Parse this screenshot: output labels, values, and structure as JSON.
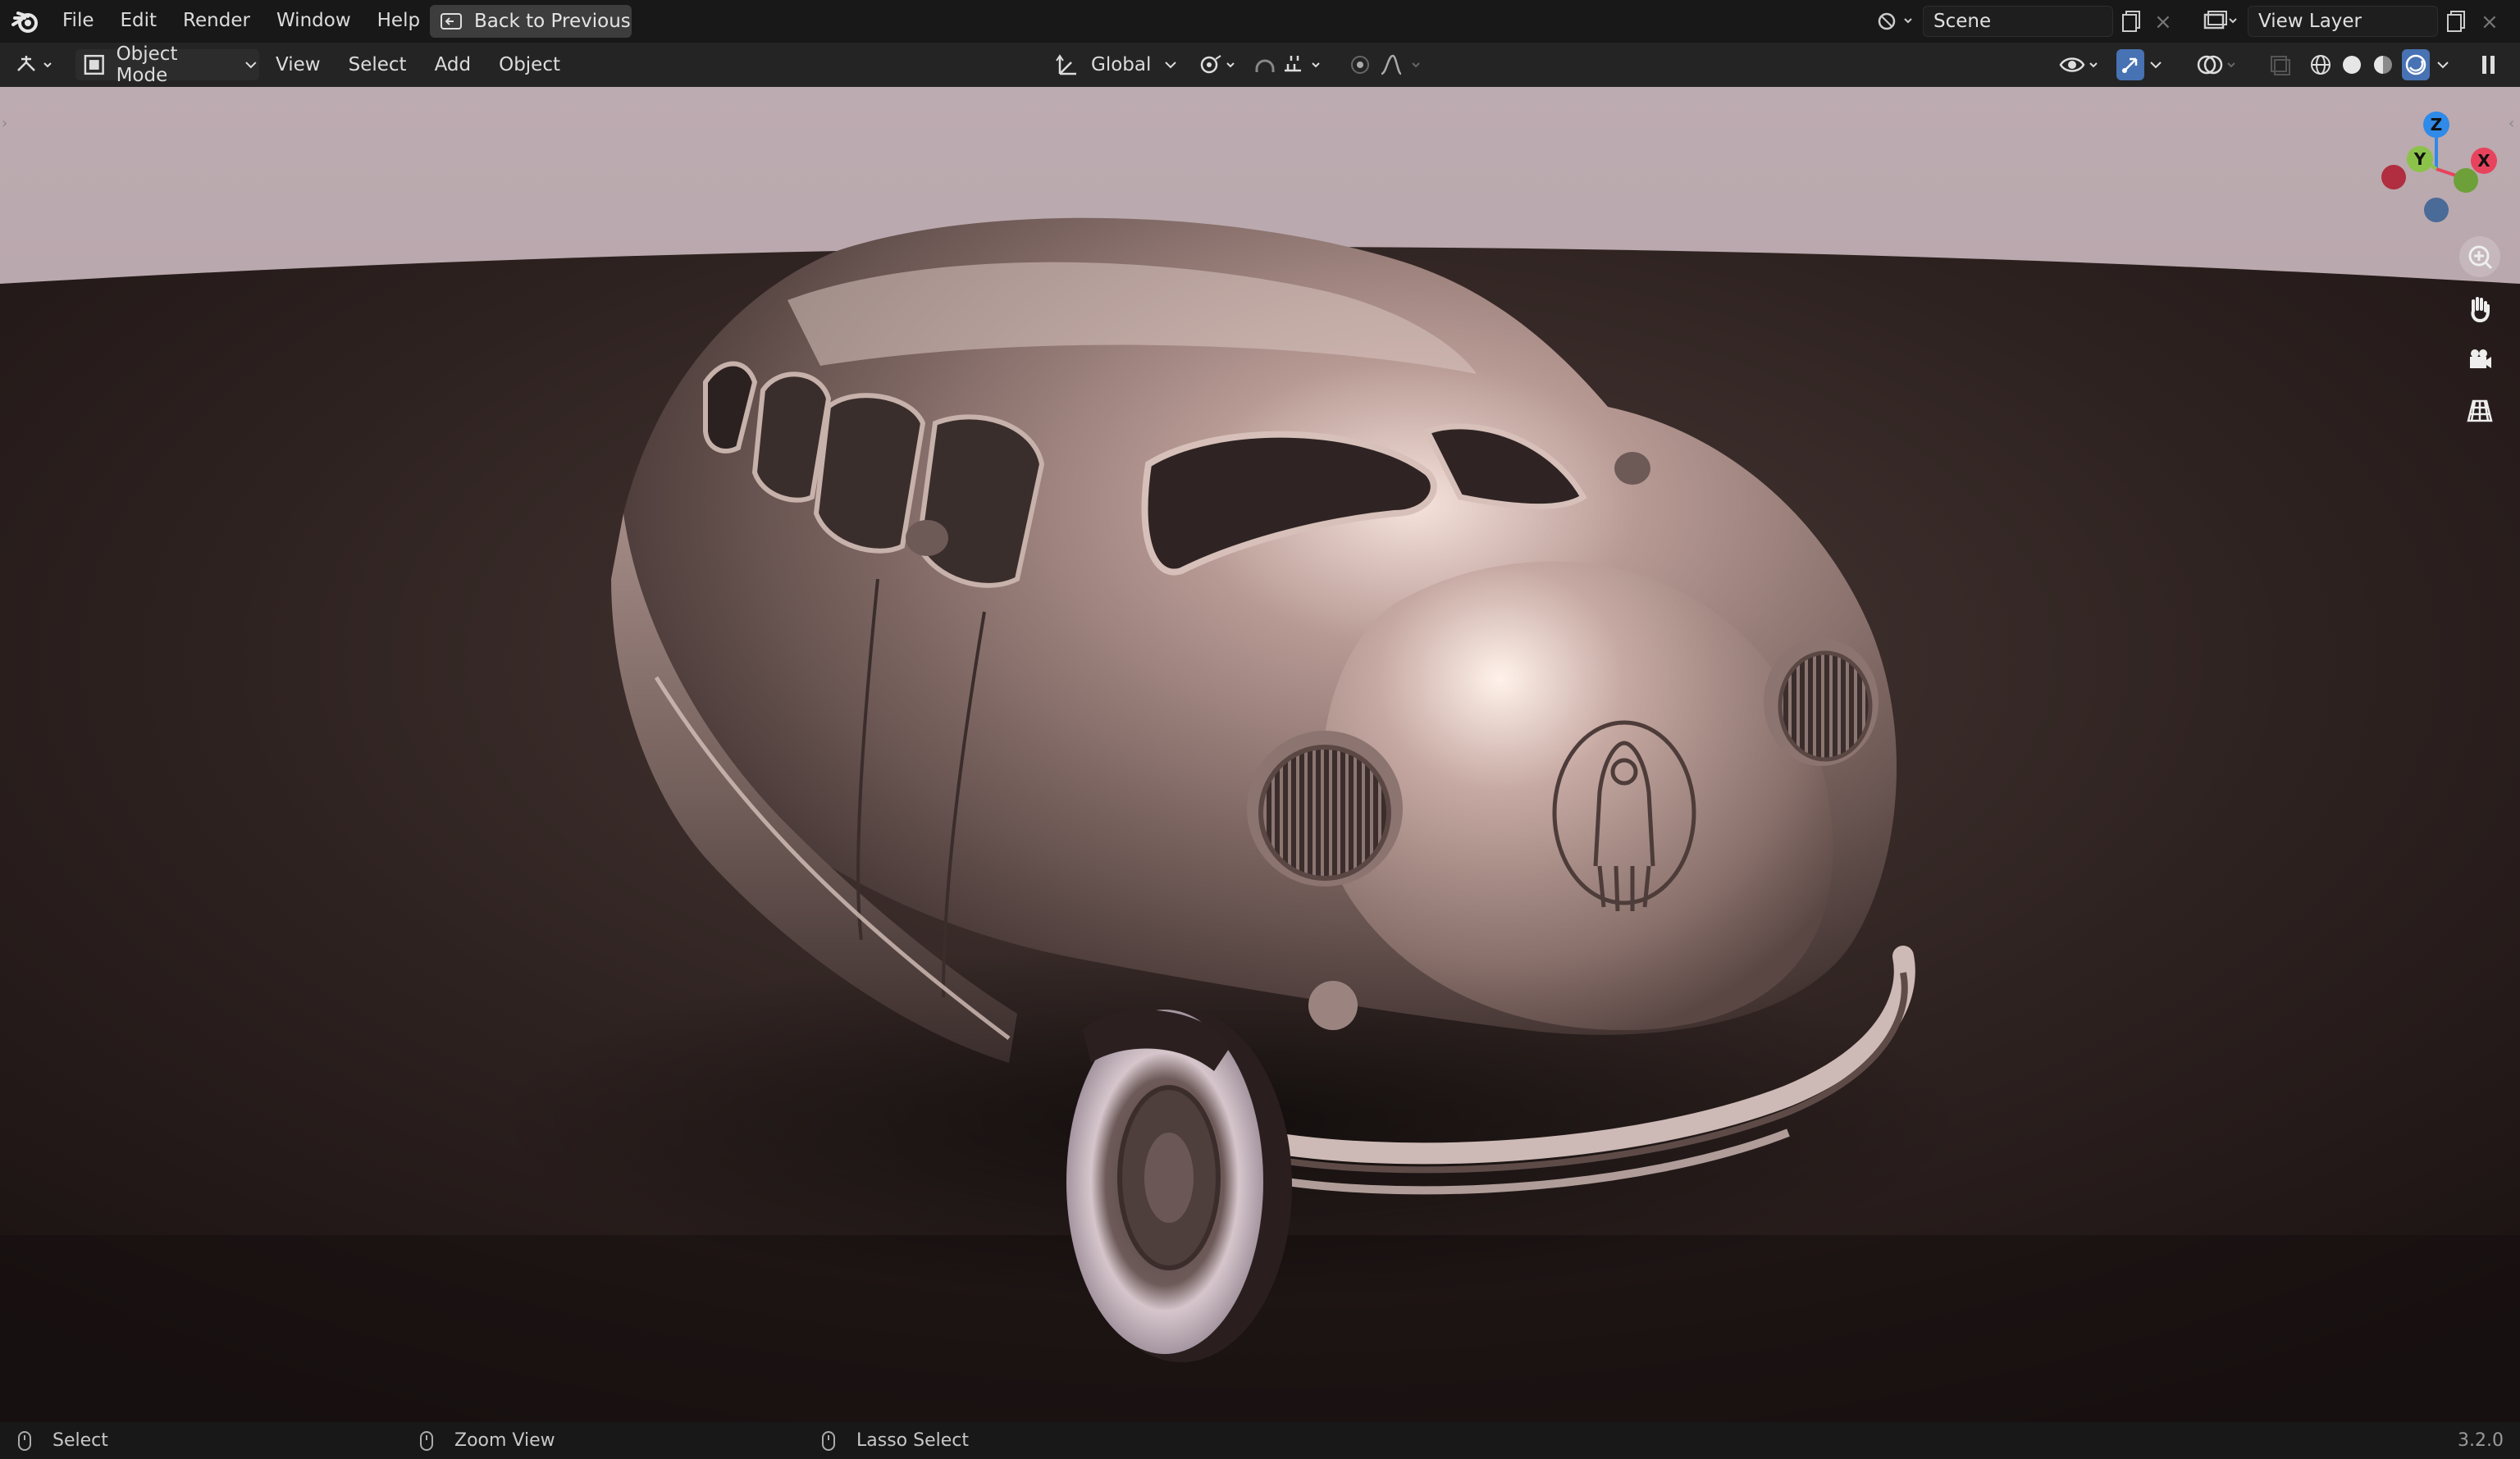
{
  "menu": {
    "items": [
      "File",
      "Edit",
      "Render",
      "Window",
      "Help"
    ],
    "back_button": "Back to Previous"
  },
  "scene": {
    "name": "Scene"
  },
  "view_layer": {
    "name": "View Layer"
  },
  "toolbar": {
    "mode": "Object Mode",
    "items": [
      "View",
      "Select",
      "Add",
      "Object"
    ],
    "transform_orientation": "Global"
  },
  "gizmo": {
    "x": "X",
    "y": "Y",
    "z": "Z"
  },
  "statusbar": {
    "select": "Select",
    "zoom": "Zoom View",
    "lasso": "Lasso Select",
    "version": "3.2.0"
  },
  "colors": {
    "accent_blue": "#4772b3",
    "axis_x": "#e8435d",
    "axis_y": "#8bc34a",
    "axis_z": "#2f8ae8"
  },
  "icons": [
    "blender-logo-icon",
    "back-icon",
    "editor-type-icon",
    "object-mode-icon",
    "orientation-icon",
    "pivot-icon",
    "snap-icon",
    "proportional-icon",
    "visibility-icon",
    "gizmo-icon",
    "overlay-icon",
    "xray-icon",
    "wireframe-icon",
    "solid-icon",
    "material-icon",
    "rendered-icon",
    "zoom-icon",
    "pan-hand-icon",
    "camera-icon",
    "grid-icon"
  ]
}
